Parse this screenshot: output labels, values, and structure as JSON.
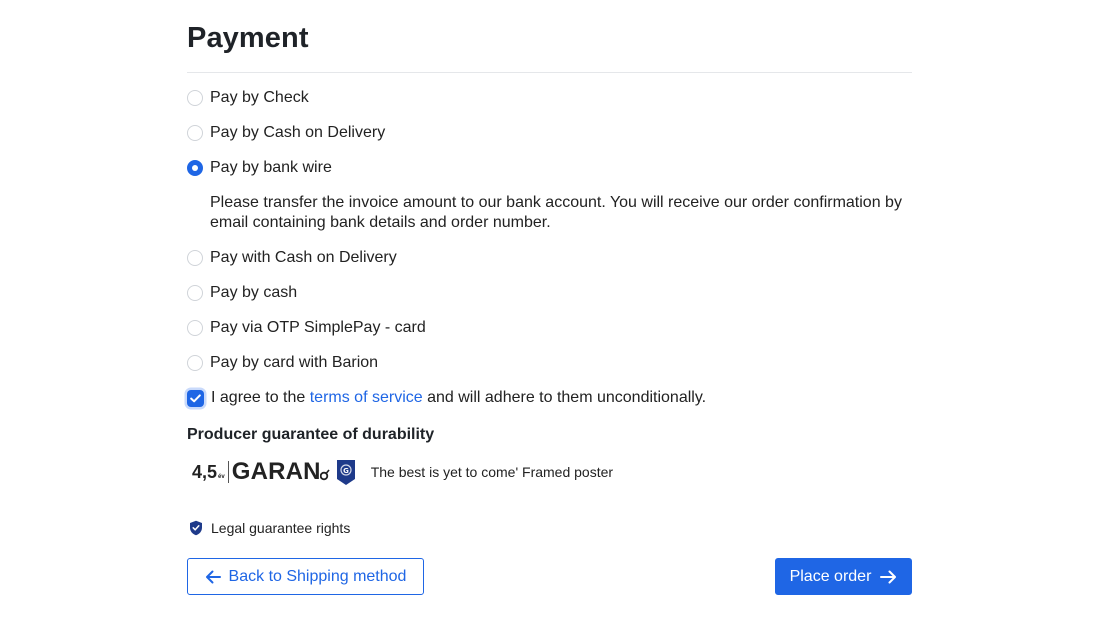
{
  "page": {
    "title": "Payment"
  },
  "payment_options": [
    {
      "label": "Pay by Check",
      "selected": false
    },
    {
      "label": "Pay by Cash on Delivery",
      "selected": false
    },
    {
      "label": "Pay by bank wire",
      "selected": true
    },
    {
      "label": "Pay with Cash on Delivery",
      "selected": false
    },
    {
      "label": "Pay by cash",
      "selected": false
    },
    {
      "label": "Pay via OTP SimplePay - card",
      "selected": false
    },
    {
      "label": "Pay by card with Barion",
      "selected": false
    }
  ],
  "bank_wire_description": "Please transfer the invoice amount to our bank account. You will receive our order confirmation by email containing bank details and order number.",
  "terms": {
    "checked": true,
    "prefix": "I agree to the ",
    "link_text": "terms of service",
    "suffix": " and will adhere to them unconditionally."
  },
  "guarantee": {
    "title": "Producer guarantee of durability",
    "rating": "4,5",
    "rating_unit": "év",
    "brand": "GARAN",
    "product_name": "The best is yet to come' Framed poster"
  },
  "legal": {
    "label": "Legal guarantee rights"
  },
  "buttons": {
    "back_label": "Back to Shipping method",
    "place_order_label": "Place order"
  },
  "colors": {
    "accent": "#1f66e5",
    "dark_shield": "#1e3a8a"
  },
  "icons": {
    "back": "arrow-left-icon",
    "place_order": "arrow-right-icon",
    "checkbox": "checkmark-icon",
    "legal": "shield-check-icon"
  }
}
